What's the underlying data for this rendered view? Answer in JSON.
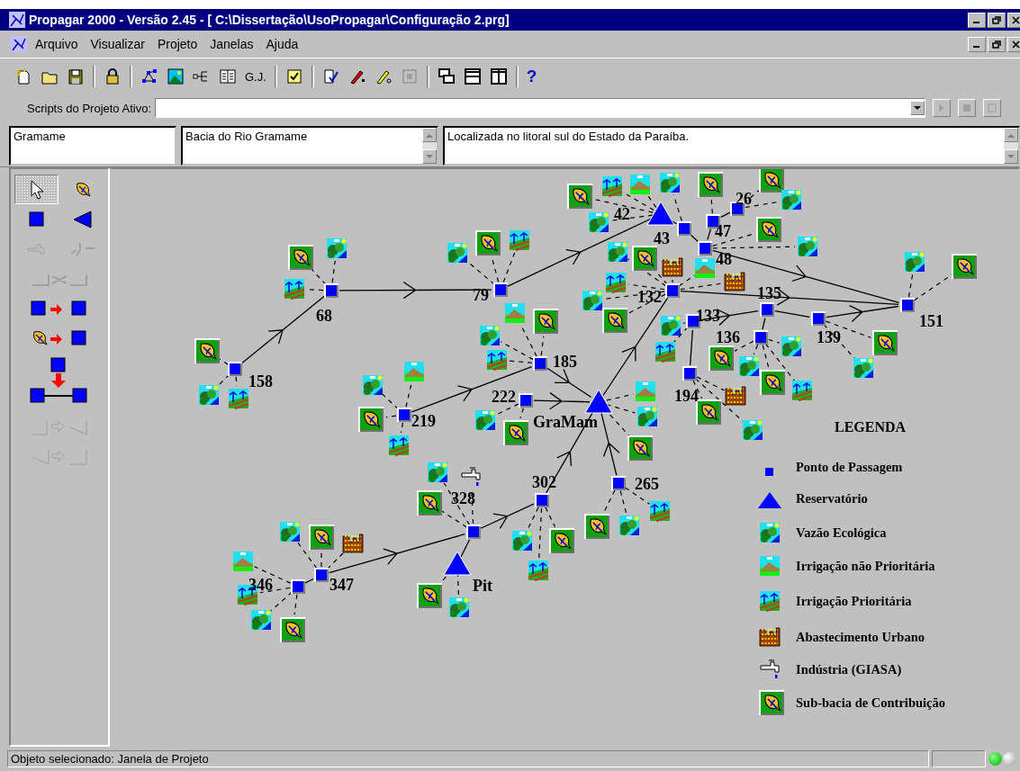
{
  "window": {
    "title": "Propagar 2000 - Versão 2.45 - [ C:\\Dissertação\\UsoPropagar\\Configuração 2.prg]"
  },
  "menu": [
    {
      "label": "Arquivo"
    },
    {
      "label": "Visualizar"
    },
    {
      "label": "Projeto"
    },
    {
      "label": "Janelas"
    },
    {
      "label": "Ajuda"
    }
  ],
  "toolbar": {
    "labels": [
      {
        "text": "G.J.",
        "kind": "plain"
      },
      {
        "text": "?",
        "kind": "help"
      }
    ]
  },
  "scripts": {
    "label": "Scripts do Projeto Ativo:"
  },
  "project": {
    "name": "Gramame",
    "title": "Bacia do Rio Gramame",
    "description": "Localizada no litoral sul do Estado da Paraíba."
  },
  "tools": [
    {
      "selected": true,
      "disabled": false
    },
    {
      "selected": false,
      "disabled": false
    },
    {
      "selected": false,
      "disabled": false
    },
    {
      "selected": false,
      "disabled": false
    },
    {
      "selected": false,
      "disabled": true
    },
    {
      "selected": false,
      "disabled": true
    },
    {
      "selected": false,
      "disabled": true
    },
    {
      "selected": false,
      "disabled": false
    },
    {
      "selected": false,
      "disabled": false
    },
    {
      "selected": false,
      "disabled": false
    },
    {
      "selected": false,
      "disabled": true
    },
    {
      "selected": false,
      "disabled": true
    }
  ],
  "network": {
    "nodes": [
      {
        "label": "68",
        "kind": "junction"
      },
      {
        "label": "79",
        "kind": "junction"
      },
      {
        "label": "158",
        "kind": "junction"
      },
      {
        "label": "219",
        "kind": "junction"
      },
      {
        "label": "185",
        "kind": "junction"
      },
      {
        "label": "222",
        "kind": "junction"
      },
      {
        "label": "GraMam",
        "kind": "reservoir"
      },
      {
        "label": "42",
        "kind": "reservoir"
      },
      {
        "label": "43",
        "kind": "junction"
      },
      {
        "label": "47",
        "kind": "junction"
      },
      {
        "label": "26",
        "kind": "junction"
      },
      {
        "label": "48",
        "kind": "junction"
      },
      {
        "label": "132",
        "kind": "junction"
      },
      {
        "label": "135",
        "kind": "junction"
      },
      {
        "label": "133",
        "kind": "junction"
      },
      {
        "label": "136",
        "kind": "junction"
      },
      {
        "label": "139",
        "kind": "junction"
      },
      {
        "label": "151",
        "kind": "junction"
      },
      {
        "label": "194",
        "kind": "junction"
      },
      {
        "label": "302",
        "kind": "junction"
      },
      {
        "label": "265",
        "kind": "junction"
      },
      {
        "label": "328",
        "kind": "junction"
      },
      {
        "label": "346",
        "kind": "junction"
      },
      {
        "label": "347",
        "kind": "junction"
      },
      {
        "label": "Pit",
        "kind": "reservoir"
      }
    ]
  },
  "legend": {
    "title": "LEGENDA",
    "items": [
      {
        "kind": "junction",
        "label": "Ponto de Passagem"
      },
      {
        "kind": "reservoir",
        "label": "Reservatório"
      },
      {
        "kind": "ecological",
        "label": "Vazão Ecológica"
      },
      {
        "kind": "irrigation",
        "label": "Irrigação não Prioritária"
      },
      {
        "kind": "priority_irrigation",
        "label": "Irrigação Prioritária"
      },
      {
        "kind": "urban",
        "label": "Abastecimento Urbano"
      },
      {
        "kind": "industry",
        "label": "Indústria (GIASA)"
      },
      {
        "kind": "subbasin",
        "label": "Sub-bacia de Contribuição"
      }
    ]
  },
  "status_bar": {
    "text": "Objeto selecionado: Janela de Projeto",
    "lights": [
      {
        "on": true
      },
      {
        "on": false
      }
    ]
  }
}
